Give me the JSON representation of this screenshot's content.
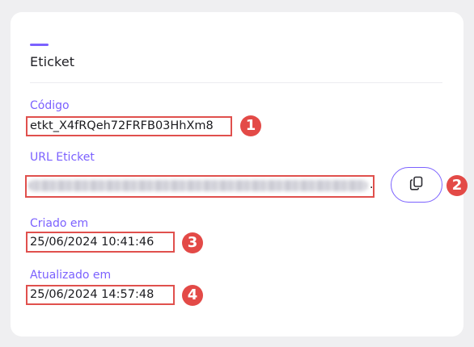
{
  "card": {
    "title": "Eticket"
  },
  "fields": {
    "codigo": {
      "label": "Código",
      "value": "etkt_X4fRQeh72FRFB03HhXm8"
    },
    "url": {
      "label": "URL Eticket",
      "value": "."
    },
    "criado": {
      "label": "Criado em",
      "value": "25/06/2024 10:41:46"
    },
    "atualizado": {
      "label": "Atualizado em",
      "value": "25/06/2024 14:57:48"
    }
  },
  "copy_button": {
    "icon": "copy-icon"
  },
  "annotations": [
    "1",
    "2",
    "3",
    "4"
  ],
  "colors": {
    "accent": "#7b61ff",
    "highlight": "#e0504d",
    "badge": "#e34a47"
  }
}
